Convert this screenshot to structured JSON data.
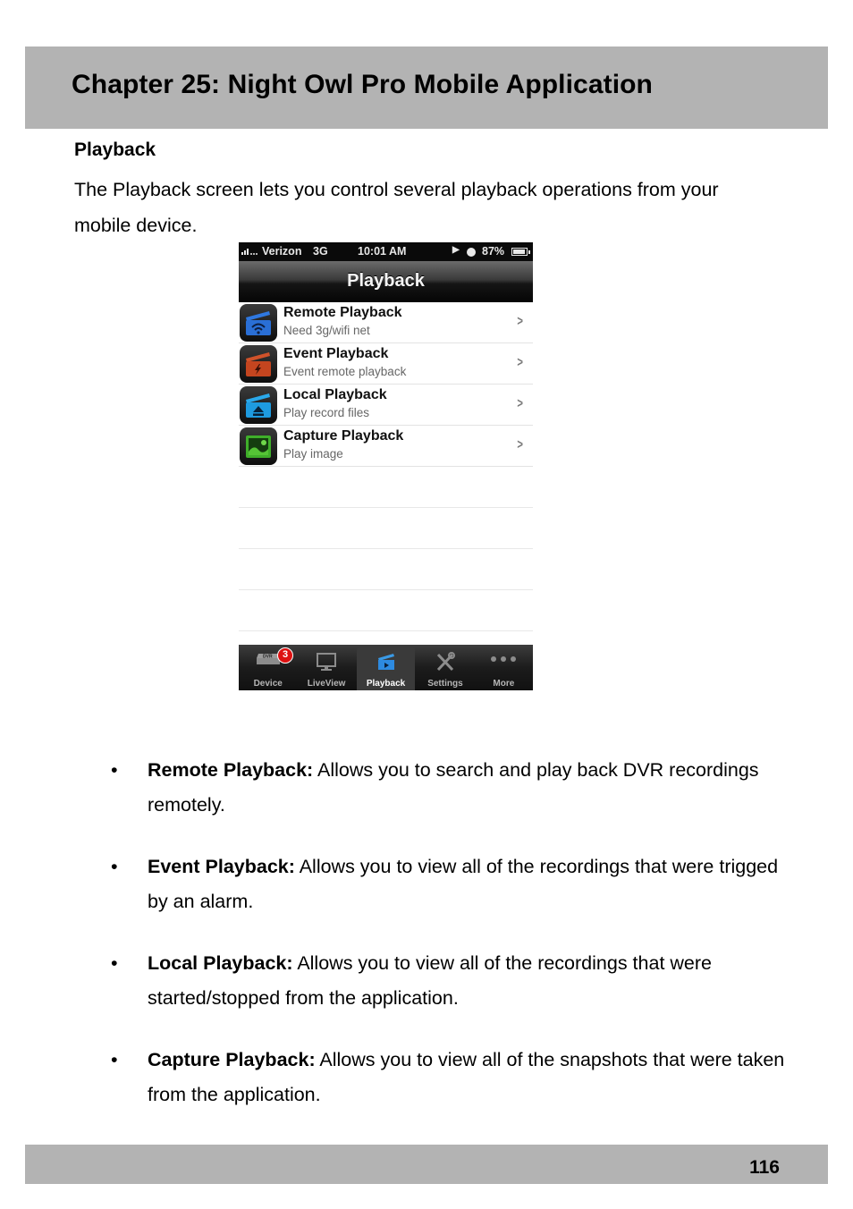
{
  "header": {
    "chapter_title": "Chapter 25: Night Owl Pro Mobile Application"
  },
  "section": {
    "heading": "Playback",
    "intro": "The Playback screen lets you control several playback operations from your mobile device."
  },
  "phone": {
    "status_bar": {
      "carrier": "Verizon",
      "network": "3G",
      "time": "10:01 AM",
      "battery": "87%"
    },
    "nav_title": "Playback",
    "menu": [
      {
        "title": "Remote Playback",
        "subtitle": "Need 3g/wifi net",
        "icon": "clapper-wifi-icon",
        "color": "#2a6fd6"
      },
      {
        "title": "Event Playback",
        "subtitle": "Event remote playback",
        "icon": "clapper-lightning-icon",
        "color": "#c4451f"
      },
      {
        "title": "Local Playback",
        "subtitle": "Play record files",
        "icon": "clapper-eject-icon",
        "color": "#1e9be0"
      },
      {
        "title": "Capture Playback",
        "subtitle": "Play image",
        "icon": "image-icon",
        "color": "#3fae2a"
      }
    ],
    "tabs": [
      {
        "label": "Device",
        "icon": "dvr-icon",
        "badge": "3"
      },
      {
        "label": "LiveView",
        "icon": "monitor-icon"
      },
      {
        "label": "Playback",
        "icon": "clapper-play-icon",
        "active": true
      },
      {
        "label": "Settings",
        "icon": "tools-icon"
      },
      {
        "label": "More",
        "icon": "more-dots-icon"
      }
    ]
  },
  "bullets": [
    {
      "term": "Remote Playback:",
      "text": " Allows you to search and play back DVR recordings remotely."
    },
    {
      "term": "Event Playback:",
      "text": " Allows you to view all of the recordings that were trigged by an alarm."
    },
    {
      "term": "Local Playback:",
      "text": " Allows you to view all of the recordings that were started/stopped from the application."
    },
    {
      "term": "Capture Playback:",
      "text": " Allows you to view all of the snapshots that were taken from the application."
    }
  ],
  "footer": {
    "page_number": "116"
  }
}
